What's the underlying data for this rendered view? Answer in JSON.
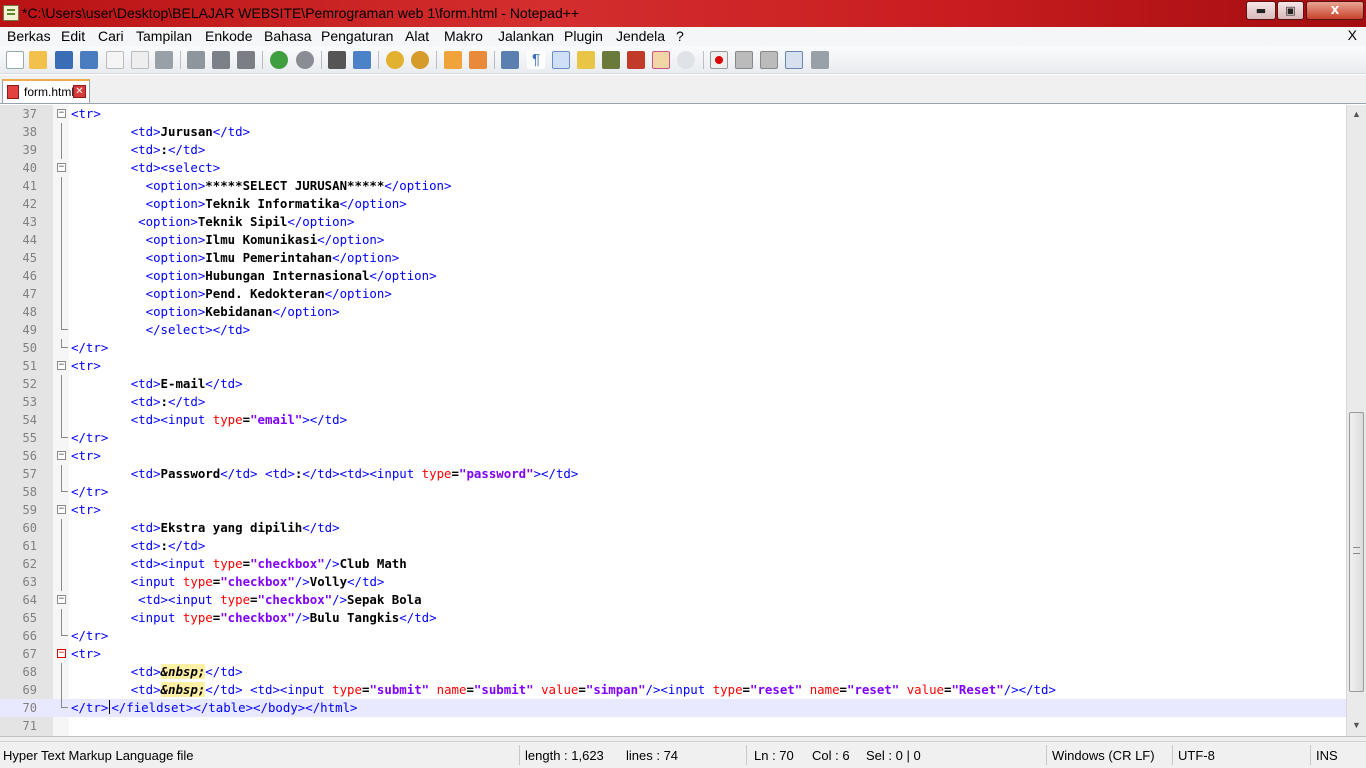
{
  "window": {
    "title": "*C:\\Users\\user\\Desktop\\BELAJAR WEBSITE\\Pemrograman web 1\\form.html - Notepad++",
    "minimize": "▬",
    "maximize": "▣",
    "close": "X"
  },
  "menu": {
    "items": [
      "Berkas",
      "Edit",
      "Cari",
      "Tampilan",
      "Enkode",
      "Bahasa",
      "Pengaturan",
      "Alat",
      "Makro",
      "Jalankan",
      "Plugin",
      "Jendela",
      "?"
    ],
    "doc_close": "X"
  },
  "toolbar": {
    "icons": [
      "new-file-icon",
      "open-file-icon",
      "save-icon",
      "save-all-icon",
      "close-icon",
      "close-all-icon",
      "print-icon",
      "cut-icon",
      "copy-icon",
      "paste-icon",
      "undo-icon",
      "redo-icon",
      "find-icon",
      "replace-icon",
      "zoom-in-icon",
      "zoom-out-icon",
      "sync-vertical-icon",
      "sync-horizontal-icon",
      "word-wrap-icon",
      "show-all-chars-icon",
      "indent-guide-icon",
      "udl-icon",
      "doc-map-icon",
      "function-list-icon",
      "folder-as-workspace-icon",
      "monitoring-icon",
      "record-macro-icon",
      "stop-record-icon",
      "playback-macro-icon",
      "run-macro-multiple-icon",
      "save-macro-icon"
    ],
    "active_icon": "indent-guide-icon"
  },
  "tabs": [
    {
      "label": "form.html",
      "active": true,
      "modified": true
    }
  ],
  "editor": {
    "current_line": 70,
    "lines": [
      {
        "n": "37",
        "fold": "open"
      },
      {
        "n": "38"
      },
      {
        "n": "39"
      },
      {
        "n": "40",
        "fold": "open"
      },
      {
        "n": "41"
      },
      {
        "n": "42"
      },
      {
        "n": "43"
      },
      {
        "n": "44"
      },
      {
        "n": "45"
      },
      {
        "n": "46"
      },
      {
        "n": "47"
      },
      {
        "n": "48"
      },
      {
        "n": "49",
        "fold": "end"
      },
      {
        "n": "50",
        "fold": "end"
      },
      {
        "n": "51",
        "fold": "open"
      },
      {
        "n": "52"
      },
      {
        "n": "53"
      },
      {
        "n": "54"
      },
      {
        "n": "55",
        "fold": "end"
      },
      {
        "n": "56",
        "fold": "open"
      },
      {
        "n": "57"
      },
      {
        "n": "58",
        "fold": "end"
      },
      {
        "n": "59",
        "fold": "open"
      },
      {
        "n": "60"
      },
      {
        "n": "61"
      },
      {
        "n": "62"
      },
      {
        "n": "63"
      },
      {
        "n": "64",
        "fold": "open"
      },
      {
        "n": "65"
      },
      {
        "n": "66",
        "fold": "end"
      },
      {
        "n": "67",
        "fold": "open-red"
      },
      {
        "n": "68"
      },
      {
        "n": "69"
      },
      {
        "n": "70",
        "fold": "end"
      },
      {
        "n": "71"
      }
    ],
    "code": [
      [
        [
          "t",
          "<tr>"
        ]
      ],
      [
        [
          "s",
          "        "
        ],
        [
          "t",
          "<td>"
        ],
        [
          "x",
          "Jurusan"
        ],
        [
          "t",
          "</td>"
        ]
      ],
      [
        [
          "s",
          "        "
        ],
        [
          "t",
          "<td>"
        ],
        [
          "x",
          ":"
        ],
        [
          "t",
          "</td>"
        ]
      ],
      [
        [
          "s",
          "        "
        ],
        [
          "t",
          "<td><select>"
        ]
      ],
      [
        [
          "s",
          "          "
        ],
        [
          "t",
          "<option>"
        ],
        [
          "x",
          "*****SELECT JURUSAN*****"
        ],
        [
          "t",
          "</option>"
        ]
      ],
      [
        [
          "s",
          "          "
        ],
        [
          "t",
          "<option>"
        ],
        [
          "x",
          "Teknik Informatika"
        ],
        [
          "t",
          "</option>"
        ]
      ],
      [
        [
          "s",
          "         "
        ],
        [
          "t",
          "<option>"
        ],
        [
          "x",
          "Teknik Sipil"
        ],
        [
          "t",
          "</option>"
        ]
      ],
      [
        [
          "s",
          "          "
        ],
        [
          "t",
          "<option>"
        ],
        [
          "x",
          "Ilmu Komunikasi"
        ],
        [
          "t",
          "</option>"
        ]
      ],
      [
        [
          "s",
          "          "
        ],
        [
          "t",
          "<option>"
        ],
        [
          "x",
          "Ilmu Pemerintahan"
        ],
        [
          "t",
          "</option>"
        ]
      ],
      [
        [
          "s",
          "          "
        ],
        [
          "t",
          "<option>"
        ],
        [
          "x",
          "Hubungan Internasional"
        ],
        [
          "t",
          "</option>"
        ]
      ],
      [
        [
          "s",
          "          "
        ],
        [
          "t",
          "<option>"
        ],
        [
          "x",
          "Pend. Kedokteran"
        ],
        [
          "t",
          "</option>"
        ]
      ],
      [
        [
          "s",
          "          "
        ],
        [
          "t",
          "<option>"
        ],
        [
          "x",
          "Kebidanan"
        ],
        [
          "t",
          "</option>"
        ]
      ],
      [
        [
          "s",
          "          "
        ],
        [
          "t",
          "</select></td>"
        ]
      ],
      [
        [
          "t",
          "</tr>"
        ]
      ],
      [
        [
          "t",
          "<tr>"
        ]
      ],
      [
        [
          "s",
          "        "
        ],
        [
          "t",
          "<td>"
        ],
        [
          "x",
          "E-mail"
        ],
        [
          "t",
          "</td>"
        ]
      ],
      [
        [
          "s",
          "        "
        ],
        [
          "t",
          "<td>"
        ],
        [
          "x",
          ":"
        ],
        [
          "t",
          "</td>"
        ]
      ],
      [
        [
          "s",
          "        "
        ],
        [
          "t",
          "<td><input "
        ],
        [
          "a",
          "type"
        ],
        [
          "x",
          "="
        ],
        [
          "v",
          "\"email\""
        ],
        [
          "t",
          "></td>"
        ]
      ],
      [
        [
          "t",
          "</tr>"
        ]
      ],
      [
        [
          "t",
          "<tr>"
        ]
      ],
      [
        [
          "s",
          "        "
        ],
        [
          "t",
          "<td>"
        ],
        [
          "x",
          "Password"
        ],
        [
          "t",
          "</td>"
        ],
        [
          "x",
          " "
        ],
        [
          "t",
          "<td>"
        ],
        [
          "x",
          ":"
        ],
        [
          "t",
          "</td><td><input "
        ],
        [
          "a",
          "type"
        ],
        [
          "x",
          "="
        ],
        [
          "v",
          "\"password\""
        ],
        [
          "t",
          "></td>"
        ]
      ],
      [
        [
          "t",
          "</tr>"
        ]
      ],
      [
        [
          "t",
          "<tr>"
        ]
      ],
      [
        [
          "s",
          "        "
        ],
        [
          "t",
          "<td>"
        ],
        [
          "x",
          "Ekstra yang dipilih"
        ],
        [
          "t",
          "</td>"
        ]
      ],
      [
        [
          "s",
          "        "
        ],
        [
          "t",
          "<td>"
        ],
        [
          "x",
          ":"
        ],
        [
          "t",
          "</td>"
        ]
      ],
      [
        [
          "s",
          "        "
        ],
        [
          "t",
          "<td><input "
        ],
        [
          "a",
          "type"
        ],
        [
          "x",
          "="
        ],
        [
          "v",
          "\"checkbox\""
        ],
        [
          "t",
          "/>"
        ],
        [
          "x",
          "Club Math"
        ]
      ],
      [
        [
          "s",
          "        "
        ],
        [
          "t",
          "<input "
        ],
        [
          "a",
          "type"
        ],
        [
          "x",
          "="
        ],
        [
          "v",
          "\"checkbox\""
        ],
        [
          "t",
          "/>"
        ],
        [
          "x",
          "Volly"
        ],
        [
          "t",
          "</td>"
        ]
      ],
      [
        [
          "s",
          "         "
        ],
        [
          "t",
          "<td><input "
        ],
        [
          "a",
          "type"
        ],
        [
          "x",
          "="
        ],
        [
          "v",
          "\"checkbox\""
        ],
        [
          "t",
          "/>"
        ],
        [
          "x",
          "Sepak Bola"
        ]
      ],
      [
        [
          "s",
          "        "
        ],
        [
          "t",
          "<input "
        ],
        [
          "a",
          "type"
        ],
        [
          "x",
          "="
        ],
        [
          "v",
          "\"checkbox\""
        ],
        [
          "t",
          "/>"
        ],
        [
          "x",
          "Bulu Tangkis"
        ],
        [
          "t",
          "</td>"
        ]
      ],
      [
        [
          "t",
          "</tr>"
        ]
      ],
      [
        [
          "t",
          "<tr>"
        ]
      ],
      [
        [
          "s",
          "        "
        ],
        [
          "t",
          "<td>"
        ],
        [
          "e",
          "&nbsp;"
        ],
        [
          "t",
          "</td>"
        ]
      ],
      [
        [
          "s",
          "        "
        ],
        [
          "t",
          "<td>"
        ],
        [
          "e",
          "&nbsp;"
        ],
        [
          "t",
          "</td>"
        ],
        [
          "x",
          " "
        ],
        [
          "t",
          "<td><input "
        ],
        [
          "a",
          "type"
        ],
        [
          "x",
          "="
        ],
        [
          "v",
          "\"submit\""
        ],
        [
          "x",
          " "
        ],
        [
          "a",
          "name"
        ],
        [
          "x",
          "="
        ],
        [
          "v",
          "\"submit\""
        ],
        [
          "x",
          " "
        ],
        [
          "a",
          "value"
        ],
        [
          "x",
          "="
        ],
        [
          "v",
          "\"simpan\""
        ],
        [
          "t",
          "/><input "
        ],
        [
          "a",
          "type"
        ],
        [
          "x",
          "="
        ],
        [
          "v",
          "\"reset\""
        ],
        [
          "x",
          " "
        ],
        [
          "a",
          "name"
        ],
        [
          "x",
          "="
        ],
        [
          "v",
          "\"reset\""
        ],
        [
          "x",
          " "
        ],
        [
          "a",
          "value"
        ],
        [
          "x",
          "="
        ],
        [
          "v",
          "\"Reset\""
        ],
        [
          "t",
          "/></td>"
        ]
      ],
      [
        [
          "t",
          "</tr>"
        ],
        [
          "c",
          ""
        ],
        [
          "t",
          "</fieldset></table></body></html>"
        ]
      ],
      []
    ]
  },
  "status": {
    "file_type": "Hyper Text Markup Language file",
    "length": "length : 1,623",
    "lines": "lines : 74",
    "ln": "Ln : 70",
    "col": "Col : 6",
    "sel": "Sel : 0 | 0",
    "eol": "Windows (CR LF)",
    "encoding": "UTF-8",
    "mode": "INS"
  },
  "colors": {
    "tag": "#0000ff",
    "attribute": "#ff0000",
    "value": "#8000ff",
    "current_line_bg": "#e8e8ff",
    "title_bar": "#c81d20"
  }
}
